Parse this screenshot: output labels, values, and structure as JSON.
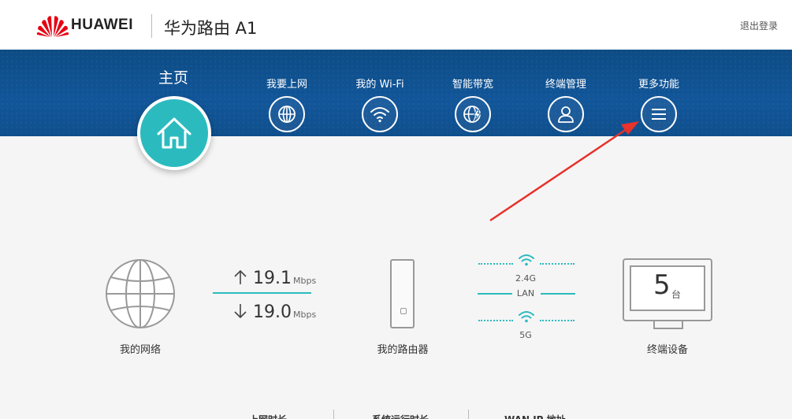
{
  "header": {
    "brand": "HUAWEI",
    "product": "华为路由 A1",
    "logout": "退出登录"
  },
  "nav": {
    "home_label": "主页",
    "items": [
      {
        "label": "我要上网",
        "icon": "globe-icon"
      },
      {
        "label": "我的 Wi-Fi",
        "icon": "wifi-icon"
      },
      {
        "label": "智能带宽",
        "icon": "smart-bandwidth-icon"
      },
      {
        "label": "终端管理",
        "icon": "user-icon"
      },
      {
        "label": "更多功能",
        "icon": "menu-icon"
      }
    ]
  },
  "status": {
    "network_label": "我的网络",
    "upload": {
      "value": "19.1",
      "unit": "Mbps"
    },
    "download": {
      "value": "19.0",
      "unit": "Mbps"
    },
    "router_label": "我的路由器",
    "band_24": "2.4G",
    "lan": "LAN",
    "band_5": "5G",
    "device_count": "5",
    "device_unit": "台",
    "devices_label": "终端设备"
  },
  "bottom_tabs": [
    "上网时长",
    "系统运行时长",
    "WAN IP 地址"
  ],
  "colors": {
    "nav_blue": "#12569a",
    "accent_teal": "#2bbbbf",
    "huawei_red": "#e60012",
    "arrow_red": "#e8322c"
  }
}
